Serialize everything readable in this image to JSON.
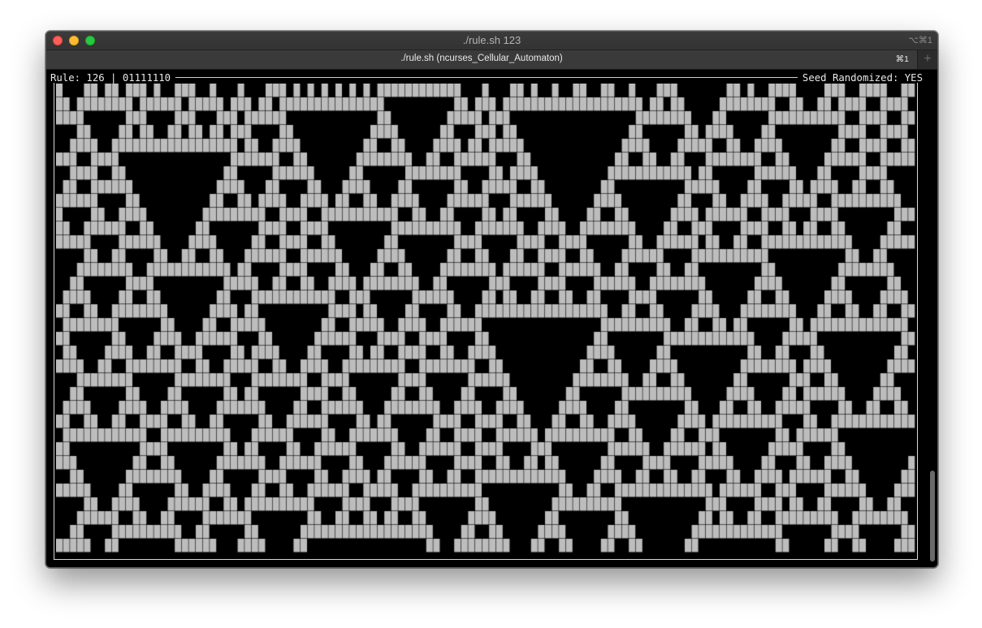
{
  "window": {
    "title": "./rule.sh 123",
    "shortcut": "⌥⌘1"
  },
  "tab": {
    "title": "./rule.sh (ncurses_Cellular_Automaton)",
    "shortcut": "⌘1",
    "new_tab": "+"
  },
  "status": {
    "rule": "Rule: 126 | 01111110",
    "seed": "Seed Randomized: YES"
  },
  "automaton": {
    "rule": 126,
    "binary": "01111110",
    "seed_randomized": true,
    "cell_color": "#bdbdbd",
    "background": "#000000"
  },
  "colors": {
    "close": "#fe5f57",
    "minimize": "#febc2e",
    "zoom": "#28c840"
  }
}
